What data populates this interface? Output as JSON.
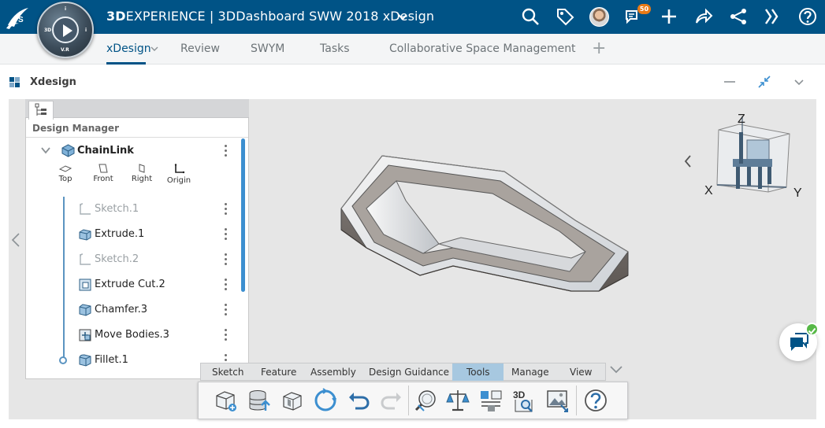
{
  "topbar": {
    "title_brand": "3D",
    "title_rest": "EXPERIENCE | 3DDashboard SWW 2018 xDesign",
    "notification_count": "50",
    "compass_labels": {
      "top": "i",
      "left": "3D",
      "right": "i",
      "bottom": "V.R"
    },
    "icons": [
      "ds-logo-icon",
      "compass-icon",
      "search-icon",
      "tag-icon",
      "avatar",
      "communication-icon",
      "add-icon",
      "share-icon",
      "network-icon",
      "apps-icon",
      "help-icon"
    ]
  },
  "tabs": [
    {
      "label": "xDesign",
      "active": true
    },
    {
      "label": "Review"
    },
    {
      "label": "SWYM"
    },
    {
      "label": "Tasks"
    },
    {
      "label": "Collaborative Space Management"
    }
  ],
  "widget": {
    "title": "Xdesign"
  },
  "design_manager": {
    "title": "Design Manager",
    "root": "ChainLink",
    "planes": [
      "Top",
      "Front",
      "Right",
      "Origin"
    ],
    "features": [
      {
        "label": "Sketch.1",
        "dimmed": true,
        "icon": "sketch-icon"
      },
      {
        "label": "Extrude.1",
        "icon": "extrude-icon"
      },
      {
        "label": "Sketch.2",
        "dimmed": true,
        "icon": "sketch-icon"
      },
      {
        "label": "Extrude Cut.2",
        "icon": "extrude-cut-icon"
      },
      {
        "label": "Chamfer.3",
        "icon": "chamfer-icon"
      },
      {
        "label": "Move Bodies.3",
        "icon": "move-bodies-icon"
      },
      {
        "label": "Fillet.1",
        "icon": "fillet-icon"
      }
    ]
  },
  "view_cube": {
    "axes": [
      "Z",
      "X",
      "Y"
    ]
  },
  "action_bar": {
    "tabs": [
      "Sketch",
      "Feature",
      "Assembly",
      "Design Guidance",
      "Tools",
      "Manage",
      "View"
    ],
    "active_tab": "Tools",
    "tools": [
      "add-part-icon",
      "upload-icon",
      "import-icon",
      "refresh-icon",
      "undo-icon",
      "redo-icon",
      "measure-icon",
      "mass-properties-icon",
      "interference-icon",
      "3d-view-icon",
      "image-icon",
      "help-icon"
    ]
  },
  "colors": {
    "brand": "#005386",
    "accent": "#3c8fd0",
    "active_tab": "#a7c8e0",
    "badge": "#e87a16"
  }
}
